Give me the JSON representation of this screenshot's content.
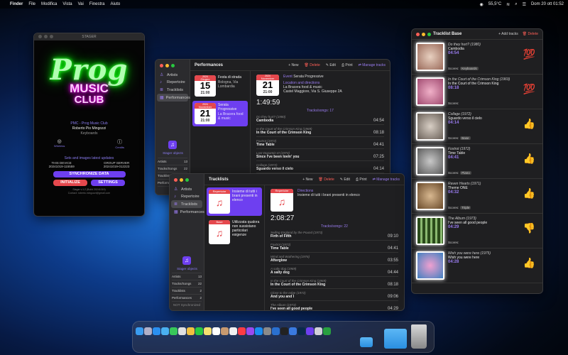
{
  "menubar": {
    "app": "Finder",
    "menus": [
      "File",
      "Modifica",
      "Vista",
      "Vai",
      "Finestra",
      "Aiuto"
    ],
    "temp": "55,5°C",
    "datetime": "Dom 20 ott 01:52"
  },
  "stager": {
    "title": "STAGER",
    "neon_line1": "Prog",
    "neon_line2": "MUSIC",
    "neon_line3": "CLUB",
    "club": "PMC - Prog Music Club",
    "person": "Roberto Pio Mingozzi",
    "role": "Keyboards",
    "wireless_label": "Wireless",
    "credits_label": "Credits",
    "sync_status": "Sets and images latest updates",
    "this_device_label": "THIS DEVICE",
    "this_device_value": "20241019-115559",
    "group_server_label": "GROUP SERVER",
    "group_server_value": "20241019-012223",
    "sync_button": "SYNCHRONIZE DATA",
    "init_button": "INITIALIZE",
    "settings_button": "SETTINGS",
    "footer1": "Stager v.1.2 (Build 20241019)",
    "footer2": "Contact: roberto.mingozzi@gmail.com"
  },
  "performances": {
    "title": "Performances",
    "actions": {
      "new": "New",
      "delete": "Delete",
      "edit": "Edit",
      "print": "Print",
      "manage": "Manage tracks"
    },
    "sidebar": [
      "Artists",
      "Repertoire",
      "Tracklists",
      "Performances"
    ],
    "logo_caption": "Stager objects",
    "stats": [
      {
        "label": "Artists",
        "value": "13"
      },
      {
        "label": "Tracks/Songs",
        "value": "22"
      },
      {
        "label": "Tracklists",
        "value": "2"
      },
      {
        "label": "Performances",
        "value": "2"
      }
    ],
    "sync_label": "Sync",
    "cards": [
      {
        "year": "2024",
        "month": "Giugno",
        "day": "15",
        "time": "21:00",
        "name": "Festa di strada",
        "place": "Bologna, Via Lombardia"
      },
      {
        "year": "2024",
        "month": "November",
        "day": "21",
        "time": "21:00",
        "name": "Serata Progressive",
        "place": "La Bracera food & music"
      }
    ],
    "detail": {
      "year": "2024",
      "month": "November",
      "day": "21",
      "time": "21:00",
      "event_label": "Event",
      "event": "Serata Progressive",
      "location_label": "Location and directions",
      "venue": "La Bracera food & music",
      "address": "Castel Maggiore, Via S. Giuseppe 2A",
      "duration": "1:49:59",
      "section": "Tracks/songs: 17",
      "tracks": [
        {
          "band": "Do they hurt? (1980)",
          "name": "Cambodia",
          "dur": "04:54"
        },
        {
          "band": "In the Court of the Crimson King (1969)",
          "name": "In the Court of the Crimson King",
          "dur": "08:18"
        },
        {
          "band": "Foxtrot (1972)",
          "name": "Time Table",
          "dur": "04:41"
        },
        {
          "band": "Lost Dopamin III (1974)",
          "name": "Since I've been lovin' you",
          "dur": "07:25"
        },
        {
          "band": "Collage (1972)",
          "name": "Sguardo verso il cielo",
          "dur": "04:14"
        }
      ]
    }
  },
  "tracklists": {
    "title": "Tracklists",
    "actions": {
      "new": "New",
      "delete": "Delete",
      "edit": "Edit",
      "print": "Print",
      "manage": "Manage tracks"
    },
    "sidebar": [
      "Artists",
      "Repertoire",
      "Tracklists",
      "Performances"
    ],
    "logo_caption": "Stager objects",
    "stats": [
      {
        "label": "Artists",
        "value": "13"
      },
      {
        "label": "Tracks/Songs",
        "value": "22"
      },
      {
        "label": "Tracklists",
        "value": "2"
      },
      {
        "label": "Performances",
        "value": "2"
      }
    ],
    "sync_label": "NOT Synchronized",
    "cards": [
      {
        "tag": "Repertoire",
        "name": "Insieme di tutti i brani presenti in elenco"
      },
      {
        "tag": "Base",
        "name": "Utilizzata qualora non sussistano particolari esigenze"
      }
    ],
    "detail": {
      "tag": "Repertoire",
      "label": "Directions",
      "desc": "Insieme di tutti i brani presenti in elenco",
      "duration": "2:08:27",
      "section": "Tracks/songs: 22",
      "tracks": [
        {
          "band": "Selling England by the Pound (1973)",
          "name": "Firth of Fifth",
          "dur": "09:10"
        },
        {
          "band": "Foxtrot (1972)",
          "name": "Time Table",
          "dur": "04:41"
        },
        {
          "band": "Wind and Wuthering (1976)",
          "name": "Afterglow",
          "dur": "03:55"
        },
        {
          "band": "A salty dog (1969)",
          "name": "A salty dog",
          "dur": "04:44"
        },
        {
          "band": "In the Court of the Crimson King (1969)",
          "name": "In the Court of the Crimson King",
          "dur": "08:18"
        },
        {
          "band": "Close to the edge (1972)",
          "name": "And you and I",
          "dur": "09:06"
        },
        {
          "band": "The Album (1973)",
          "name": "I've seen all good people",
          "dur": "04:29"
        }
      ]
    }
  },
  "tracklist_base": {
    "title": "Tracklist Base",
    "add": "Add tracks",
    "delete": "Delete",
    "score_label": "Scores:",
    "items": [
      {
        "band": "Do they hurt? (1980)",
        "name": "Cambodia",
        "dur": "04:54",
        "score": "Keyboards",
        "emoji": "💯",
        "color": "#c8a08a"
      },
      {
        "band": "In the Court of the Crimson King (1969)",
        "name": "In the Court of the Crimson King",
        "dur": "08:18",
        "score": "",
        "emoji": "💯",
        "color": "#d27fa0"
      },
      {
        "band": "Collage (1972)",
        "name": "Sguardo verso il cielo",
        "dur": "04:14",
        "score": "Base",
        "emoji": "👍",
        "color": "#9a8f85"
      },
      {
        "band": "Foxtrot (1972)",
        "name": "Time Table",
        "dur": "04:41",
        "score": "Piano",
        "emoji": "👍",
        "color": "#8a8a8a"
      },
      {
        "band": "Raven Hearts (1971)",
        "name": "Theme ONE",
        "dur": "04:32",
        "score": "Triple",
        "emoji": "👍",
        "color": "#a07850"
      },
      {
        "band": "The Album (1973)",
        "name": "I've seen all good people",
        "dur": "04:29",
        "score": "",
        "emoji": "👎",
        "color": "#4a7a3a"
      },
      {
        "band": "Wish you were here (1975)",
        "name": "Wish you were here",
        "dur": "04:28",
        "score": "",
        "emoji": "👍",
        "color": "#c070a0"
      }
    ]
  }
}
